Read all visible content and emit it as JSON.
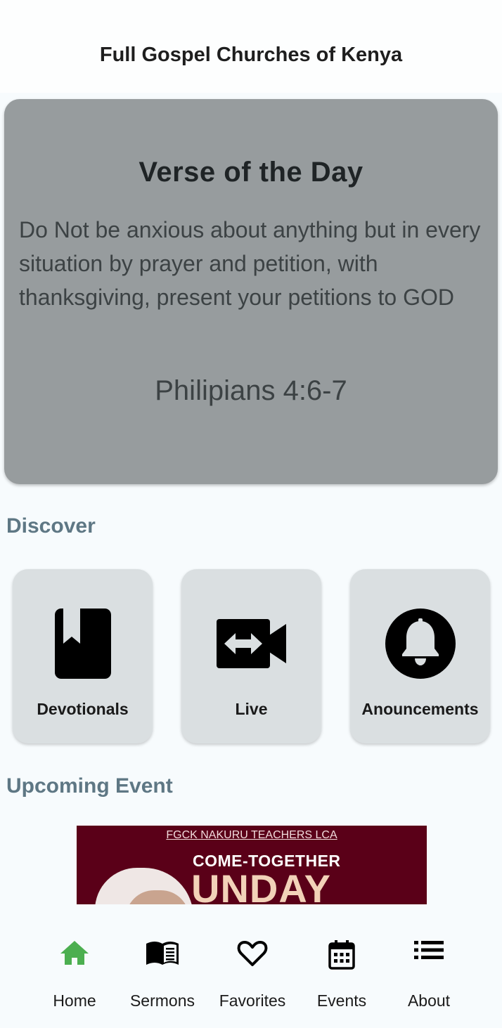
{
  "app": {
    "title": "Full Gospel Churches of Kenya"
  },
  "verse": {
    "heading": "Verse of the Day",
    "text": "Do Not be anxious about anything but in every situation by prayer and petition, with thanksgiving, present your petitions to GOD",
    "reference": "Philipians 4:6-7"
  },
  "discover": {
    "title": "Discover",
    "items": [
      {
        "label": "Devotionals",
        "icon": "book-icon"
      },
      {
        "label": "Live",
        "icon": "video-camera-icon"
      },
      {
        "label": "Anouncements",
        "icon": "bell-icon"
      }
    ]
  },
  "upcoming": {
    "title": "Upcoming Event",
    "banner": {
      "org": "FGCK NAKURU TEACHERS LCA",
      "line1": "COME-TOGETHER",
      "line2": "UNDAY"
    }
  },
  "nav": {
    "active": "Home",
    "active_color": "#4caf50",
    "items": [
      {
        "label": "Home",
        "icon": "home-icon"
      },
      {
        "label": "Sermons",
        "icon": "open-book-icon"
      },
      {
        "label": "Favorites",
        "icon": "heart-icon"
      },
      {
        "label": "Events",
        "icon": "calendar-icon"
      },
      {
        "label": "About",
        "icon": "list-icon"
      }
    ]
  }
}
